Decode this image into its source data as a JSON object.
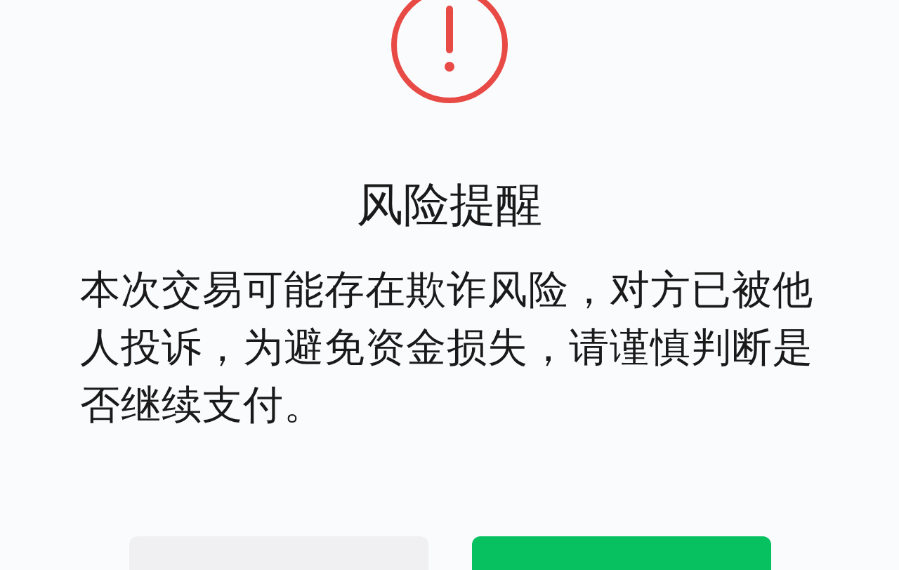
{
  "dialog": {
    "title": "风险提醒",
    "message": "本次交易可能存在欺诈风险，对方已被他人投诉，为避免资金损失，请谨慎判断是否继续支付。",
    "buttons": [
      {
        "kind": "secondary"
      },
      {
        "kind": "primary"
      }
    ]
  }
}
